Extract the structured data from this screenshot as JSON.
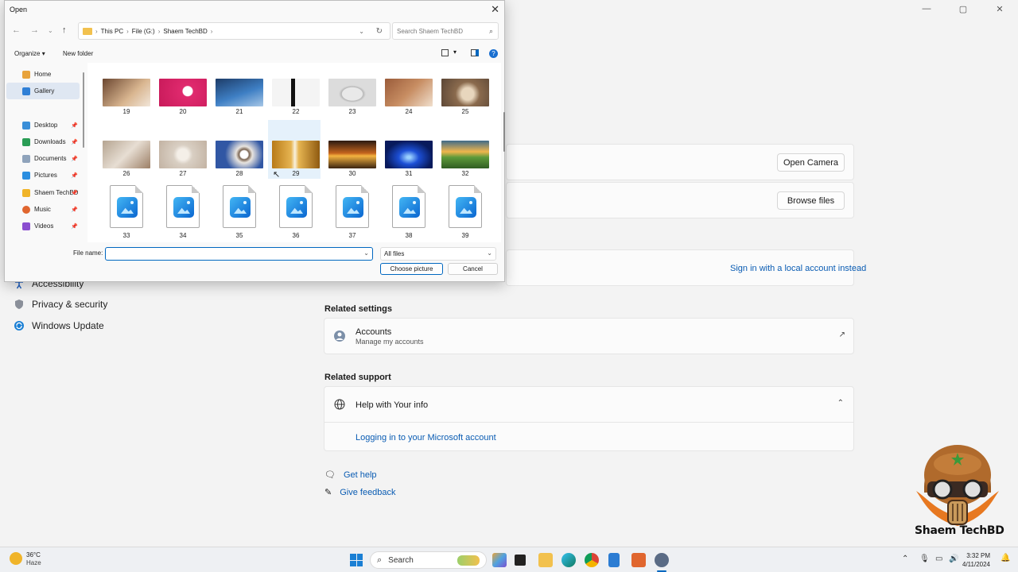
{
  "settings": {
    "sidebar": [
      {
        "label": "Accessibility",
        "icon": "accessibility-icon"
      },
      {
        "label": "Privacy & security",
        "icon": "shield-icon"
      },
      {
        "label": "Windows Update",
        "icon": "update-icon"
      }
    ],
    "open_camera_label": "Open Camera",
    "browse_files_label": "Browse files",
    "sign_in_local_link": "Sign in with a local account instead",
    "related_settings_title": "Related settings",
    "accounts_title": "Accounts",
    "accounts_subtitle": "Manage my accounts",
    "related_support_title": "Related support",
    "help_title": "Help with Your info",
    "help_link": "Logging in to your Microsoft account",
    "get_help_link": "Get help",
    "give_feedback_link": "Give feedback"
  },
  "dialog": {
    "title": "Open",
    "breadcrumb": [
      "This PC",
      "File (G:)",
      "Shaem TechBD"
    ],
    "search_placeholder": "Search Shaem TechBD",
    "organize_label": "Organize",
    "new_folder_label": "New folder",
    "nav_items": [
      {
        "label": "Home",
        "pinned": false,
        "color": "#e8a33b"
      },
      {
        "label": "Gallery",
        "pinned": false,
        "color": "#2f7fd6"
      },
      {
        "label": "Desktop",
        "pinned": true,
        "color": "#3a8fd8"
      },
      {
        "label": "Downloads",
        "pinned": true,
        "color": "#2a9d55"
      },
      {
        "label": "Documents",
        "pinned": true,
        "color": "#8fa3bb"
      },
      {
        "label": "Pictures",
        "pinned": true,
        "color": "#2b8fe0"
      },
      {
        "label": "Shaem TechBD",
        "pinned": true,
        "color": "#f0b429"
      },
      {
        "label": "Music",
        "pinned": true,
        "color": "#e0662f"
      },
      {
        "label": "Videos",
        "pinned": true,
        "color": "#8b4fd0"
      }
    ],
    "row1": [
      "19",
      "20",
      "21",
      "22",
      "23",
      "24",
      "25"
    ],
    "row2": [
      "26",
      "27",
      "28",
      "29",
      "30",
      "31",
      "32"
    ],
    "row3": [
      "33",
      "34",
      "35",
      "36",
      "37",
      "38",
      "39"
    ],
    "file_name_label": "File name:",
    "file_name_value": "",
    "filter_value": "All files",
    "choose_label": "Choose picture",
    "cancel_label": "Cancel"
  },
  "taskbar": {
    "weather_temp": "36°C",
    "weather_desc": "Haze",
    "search_label": "Search",
    "time": "3:32 PM",
    "date": "4/11/2024"
  },
  "watermark": "Shaem TechBD"
}
